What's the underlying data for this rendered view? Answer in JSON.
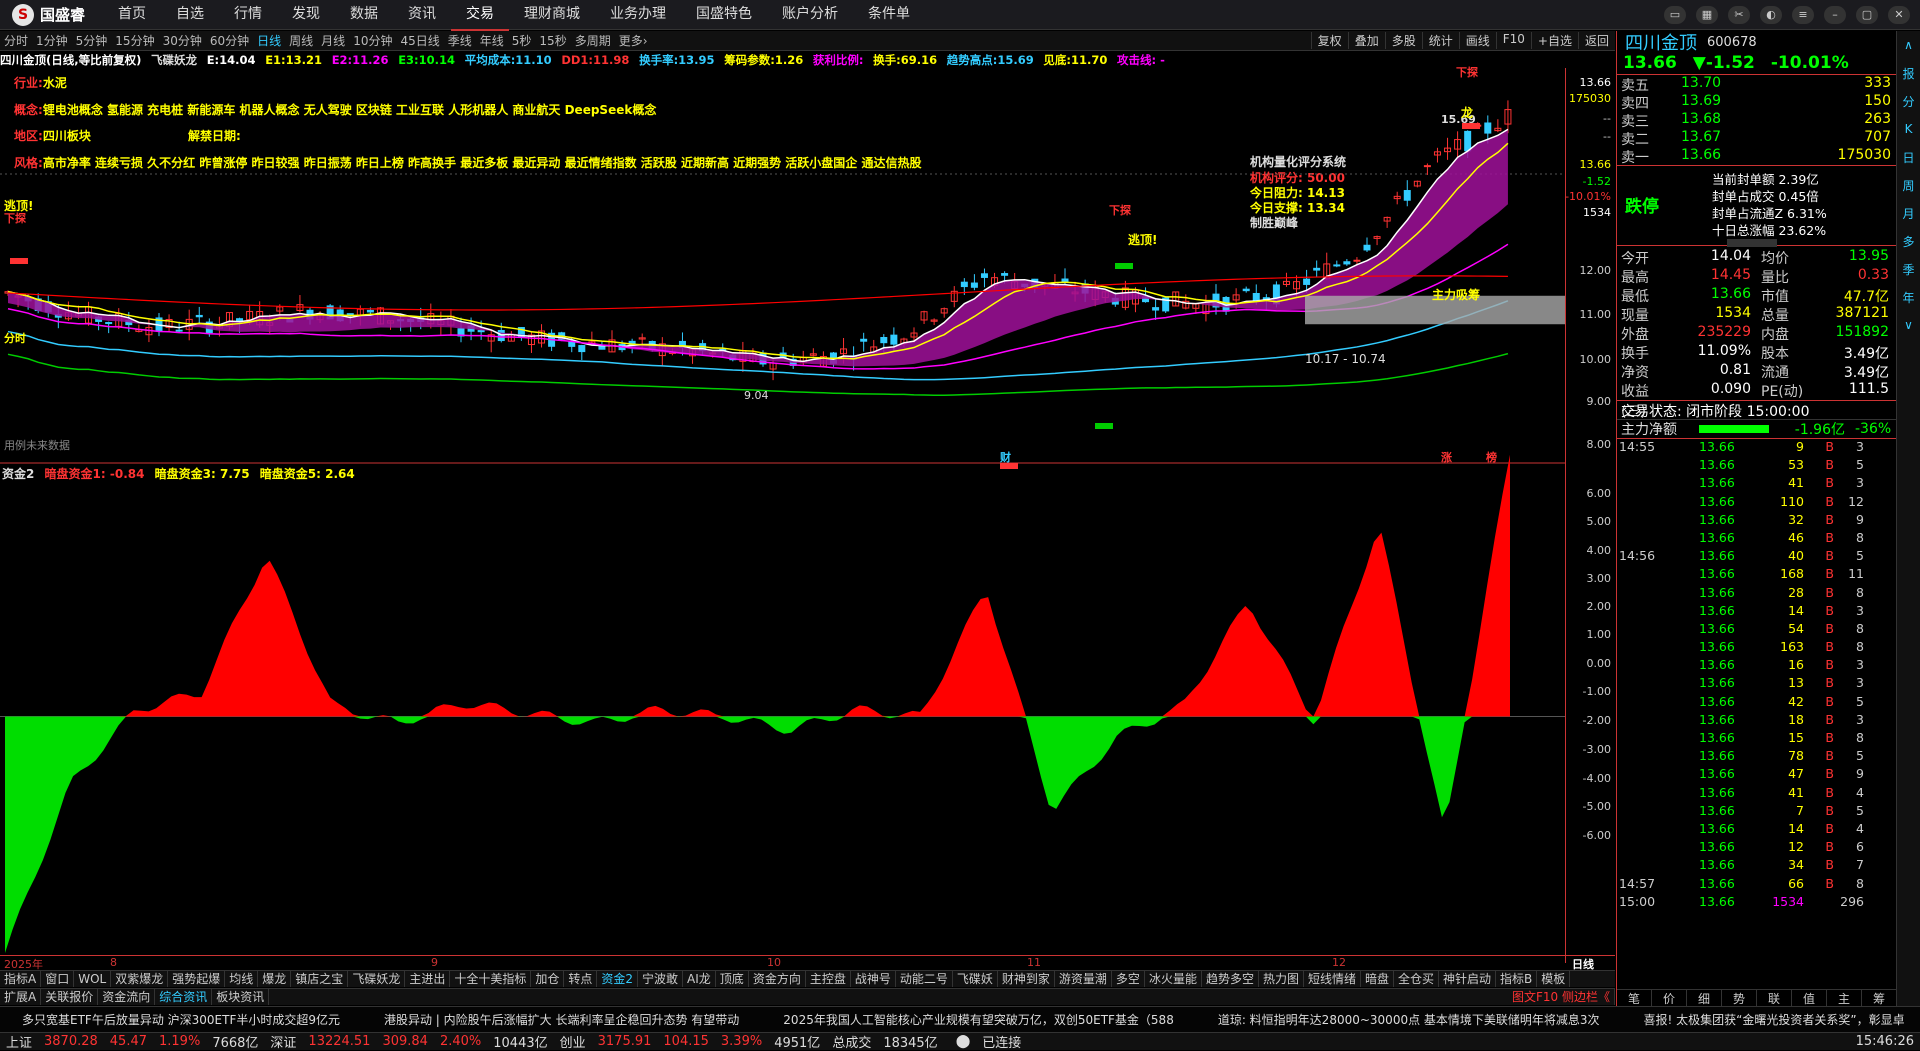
{
  "app": {
    "brand": "国盛睿",
    "nav": [
      "首页",
      "自选",
      "行情",
      "发现",
      "数据",
      "资讯",
      "交易",
      "理财商城",
      "业务办理",
      "国盛特色",
      "账户分析",
      "条件单"
    ],
    "active_nav": "交易"
  },
  "period": {
    "items": [
      "分时",
      "1分钟",
      "5分钟",
      "15分钟",
      "30分钟",
      "60分钟",
      "日线",
      "周线",
      "月线",
      "10分钟",
      "45日线",
      "季线",
      "年线",
      "5秒",
      "15秒",
      "多周期",
      "更多›"
    ],
    "active": "日线",
    "tools": [
      "复权",
      "叠加",
      "多股",
      "统计",
      "画线",
      "F10",
      "+自选",
      "返回"
    ]
  },
  "kinfo": {
    "name": "四川金顶(日线,等比前复权)",
    "indicator": "飞碟妖龙",
    "e": "E:14.04",
    "e1": "E1:13.21",
    "e2": "E2:11.26",
    "e3": "E3:10.14",
    "avgcost": "平均成本:11.10",
    "dd1": "DD1:11.98",
    "turnover": "换手率:13.95",
    "chip": "筹码参数:1.26",
    "profit": "获利比例:",
    "hand": "换手:69.16",
    "trend_high": "趋势高点:15.69",
    "bottom": "见底:11.70",
    "attack": "攻击线: -"
  },
  "tags": {
    "industry_k": "行业:",
    "industry_v": "水泥",
    "concept_k": "概念:",
    "concept_v": "锂电池概念 氢能源 充电桩 新能源车 机器人概念 无人驾驶 区块链 工业互联 人形机器人 商业航天 DeepSeek概念",
    "region_k": "地区:",
    "region_v": "四川板块",
    "unlock_k": "解禁日期:",
    "style_k": "风格:",
    "style_v": "高市净率 连续亏损 久不分红 昨曾涨停 昨日较强 昨日振荡 昨日上榜 昨高换手 最近多板 最近异动 最近情绪指数 活跃股 近期新高 近期强势 活跃小盘国企 通达信热股"
  },
  "score": {
    "title": "机构量化评分系统",
    "rating": "机构评分: 50.00",
    "resist": "今日阻力: 14.13",
    "support": "今日支撑: 13.34",
    "note": "制胜巅峰"
  },
  "annotations": {
    "escape1": "逃顶!",
    "probe": "下探",
    "escape2": "逃顶!",
    "dragon": "龙",
    "main_absorb": "主力吸筹",
    "range": "10.17 - 10.74",
    "low": "9.04",
    "fen": "分时",
    "nodata": "用例未来数据",
    "cai": "财",
    "zhang": "涨",
    "bang": "榜",
    "peak": "15.69",
    "probe2": "下探"
  },
  "yaxis": {
    "labels": [
      "13.66",
      "175030",
      "--",
      "--",
      "13.66",
      "-1.52",
      "-10.01%",
      "1534",
      "12.00",
      "11.00",
      "10.00",
      "9.00",
      "8.00"
    ]
  },
  "xaxis": {
    "labels": [
      "2025年",
      "8",
      "9",
      "10",
      "11",
      "12"
    ],
    "period_label": "日线"
  },
  "sub": {
    "name": "资金2",
    "a": "暗盘资金1: -0.84",
    "b": "暗盘资金3: 7.75",
    "c": "暗盘资金5: 2.64",
    "ticks": [
      "6.00",
      "5.00",
      "4.00",
      "3.00",
      "2.00",
      "1.00",
      "0.00",
      "-1.00",
      "-2.00",
      "-3.00",
      "-4.00",
      "-5.00",
      "-6.00"
    ]
  },
  "chart_data": [
    {
      "type": "line",
      "title": "四川金顶(日线,等比前复权)",
      "ylim": [
        8,
        14.5
      ],
      "xlabel": "",
      "ylabel": "",
      "categories": [
        "2025年",
        "8",
        "9",
        "10",
        "11",
        "12"
      ],
      "series": [
        {
          "name": "E",
          "values": [
            10.9,
            10.5,
            10.3,
            10.4,
            10.6,
            10.5,
            10.3,
            10.1,
            10.0,
            9.9,
            9.7,
            9.8,
            10.2,
            11.2,
            11.0,
            10.8,
            10.7,
            10.9,
            11.6,
            13.2,
            14.0
          ]
        }
      ]
    },
    {
      "type": "area",
      "title": "资金2",
      "ylim": [
        -7,
        7.5
      ],
      "series": [
        {
          "name": "暗盘资金3",
          "values": [
            -7.0,
            -2.0,
            0.2,
            0.7,
            4.8,
            0.3,
            -0.2,
            0.4,
            0.1,
            -0.2,
            0.2,
            0.0,
            -0.4,
            0.2,
            0.0,
            3.8,
            -2.8,
            -0.6,
            0.3,
            3.4,
            -0.1,
            5.7,
            -3.5,
            7.75
          ]
        }
      ]
    }
  ],
  "orderbook": {
    "name": "四川金顶",
    "code": "600678",
    "price": "13.66",
    "chg": "▼-1.52",
    "pct": "-10.01%",
    "asks": [
      {
        "n": "卖五",
        "p": "13.70",
        "q": "333"
      },
      {
        "n": "卖四",
        "p": "13.69",
        "q": "150"
      },
      {
        "n": "卖三",
        "p": "13.68",
        "q": "263"
      },
      {
        "n": "卖二",
        "p": "13.67",
        "q": "707"
      },
      {
        "n": "卖一",
        "p": "13.66",
        "q": "175030"
      }
    ],
    "limit": "跌停",
    "seal": [
      "当前封单额 2.39亿",
      "封单占成交 0.45倍",
      "封单占流通Z 6.31%",
      "十日总涨幅 23.62%"
    ]
  },
  "quote": [
    [
      "今开",
      "14.04",
      "均价",
      "13.95"
    ],
    [
      "最高",
      "14.45",
      "量比",
      "0.33"
    ],
    [
      "最低",
      "13.66",
      "市值",
      "47.7亿"
    ],
    [
      "现量",
      "1534",
      "总量",
      "387121"
    ],
    [
      "外盘",
      "235229",
      "内盘",
      "151892"
    ],
    [
      "换手",
      "11.09%",
      "股本",
      "3.49亿"
    ],
    [
      "净资",
      "0.81",
      "流通",
      "3.49亿"
    ],
    [
      "收益(三)",
      "0.090",
      "PE(动)",
      "111.5"
    ]
  ],
  "trade_state": "交易状态: 闭市阶段 15:00:00",
  "main_flow": {
    "label": "主力净额",
    "v": "-1.96亿",
    "p": "-36%"
  },
  "ticks": [
    [
      "14:55",
      "13.66",
      "9",
      "B",
      "3"
    ],
    [
      "",
      "13.66",
      "53",
      "B",
      "5"
    ],
    [
      "",
      "13.66",
      "41",
      "B",
      "3"
    ],
    [
      "",
      "13.66",
      "110",
      "B",
      "12"
    ],
    [
      "",
      "13.66",
      "32",
      "B",
      "9"
    ],
    [
      "",
      "13.66",
      "46",
      "B",
      "8"
    ],
    [
      "14:56",
      "13.66",
      "40",
      "B",
      "5"
    ],
    [
      "",
      "13.66",
      "168",
      "B",
      "11"
    ],
    [
      "",
      "13.66",
      "28",
      "B",
      "8"
    ],
    [
      "",
      "13.66",
      "14",
      "B",
      "3"
    ],
    [
      "",
      "13.66",
      "54",
      "B",
      "8"
    ],
    [
      "",
      "13.66",
      "163",
      "B",
      "8"
    ],
    [
      "",
      "13.66",
      "16",
      "B",
      "3"
    ],
    [
      "",
      "13.66",
      "13",
      "B",
      "3"
    ],
    [
      "",
      "13.66",
      "42",
      "B",
      "5"
    ],
    [
      "",
      "13.66",
      "18",
      "B",
      "3"
    ],
    [
      "",
      "13.66",
      "15",
      "B",
      "8"
    ],
    [
      "",
      "13.66",
      "78",
      "B",
      "5"
    ],
    [
      "",
      "13.66",
      "47",
      "B",
      "9"
    ],
    [
      "",
      "13.66",
      "41",
      "B",
      "4"
    ],
    [
      "",
      "13.66",
      "7",
      "B",
      "5"
    ],
    [
      "",
      "13.66",
      "14",
      "B",
      "4"
    ],
    [
      "",
      "13.66",
      "12",
      "B",
      "6"
    ],
    [
      "",
      "13.66",
      "34",
      "B",
      "7"
    ],
    [
      "14:57",
      "13.66",
      "66",
      "B",
      "8"
    ],
    [
      "15:00",
      "13.66",
      "1534",
      "",
      "296"
    ]
  ],
  "rtabs": [
    "笔",
    "价",
    "细",
    "势",
    "联",
    "值",
    "主",
    "筹"
  ],
  "sidebar": [
    "∧",
    "报",
    "分",
    "K",
    "日",
    "周",
    "月",
    "多",
    "季",
    "年",
    "∨"
  ],
  "tabs1": [
    "指标A",
    "窗口",
    "WOL",
    "双紫爆龙",
    "强势起爆",
    "均线",
    "爆龙",
    "镇店之宝",
    "飞碟妖龙",
    "主进出",
    "十全十美指标",
    "加仓",
    "转点",
    "资金2",
    "宁波敢",
    "AI龙",
    "顶底",
    "资金方向",
    "主控盘",
    "战神号",
    "动能二号",
    "飞碟妖",
    "财神到家",
    "游资量潮",
    "多空",
    "冰火量能",
    "趋势多空",
    "热力图",
    "短线情绪",
    "暗盘",
    "全仓买",
    "神针启动",
    "指标B",
    "模板"
  ],
  "tabs2": [
    "扩展A",
    "关联报价",
    "资金流向",
    "综合资讯",
    "板块资讯"
  ],
  "tabs2_right": "图文F10 侧边栏《",
  "ticker": [
    "多只宽基ETF午后放量异动 沪深300ETF半小时成交超9亿元",
    "港股异动 | 内险股午后涨幅扩大 长端利率呈企稳回升态势 有望带动",
    "2025年我国人工智能核心产业规模有望突破万亿，双创50ETF基金（588",
    "道琼: 料恒指明年达28000~30000点 基本情境下美联储明年将减息3次",
    "喜报! 太极集团获“金曙光投资者关系奖”，彰显卓"
  ],
  "status": {
    "sh": "上证",
    "sh_v": "3870.28",
    "sh_c": "45.47",
    "sh_p": "1.19%",
    "sh_a": "7668亿",
    "sz": "深证",
    "sz_v": "13224.51",
    "sz_c": "309.84",
    "sz_p": "2.40%",
    "sz_a": "10443亿",
    "cy": "创业",
    "cy_v": "3175.91",
    "cy_c": "104.15",
    "cy_p": "3.39%",
    "cy_a": "4951亿",
    "tot": "总成交",
    "tot_v": "18345亿",
    "conn": "已连接",
    "time": "15:46:26"
  }
}
